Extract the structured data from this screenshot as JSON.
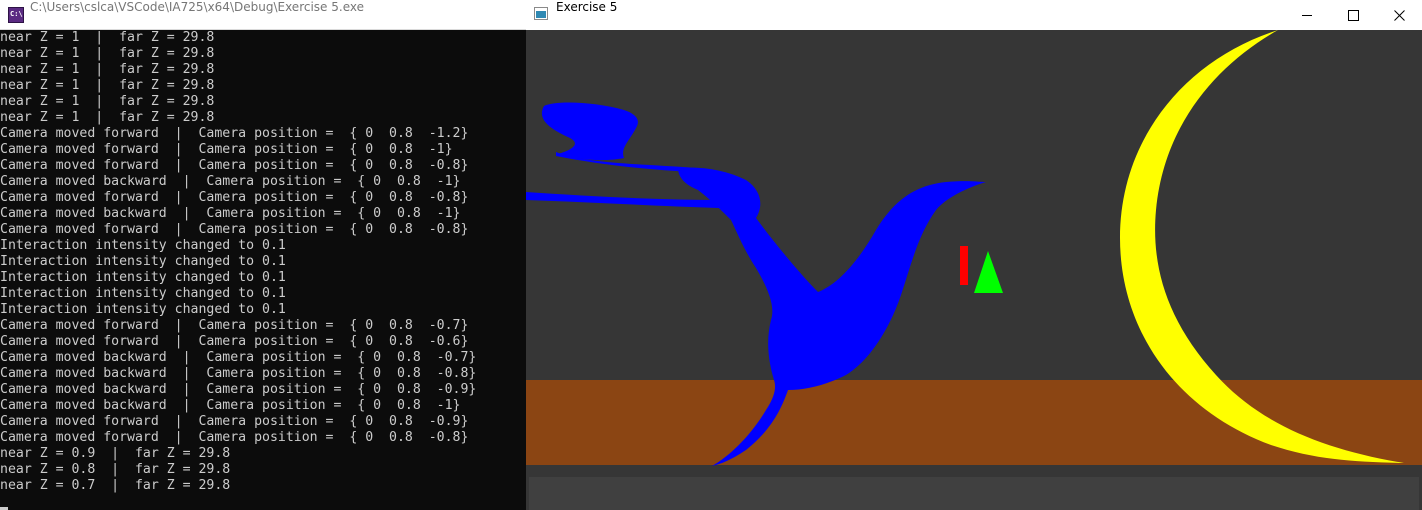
{
  "console": {
    "title": "C:\\Users\\cslca\\VSCode\\IA725\\x64\\Debug\\Exercise 5.exe",
    "icon": "console-app-icon",
    "icon_text": "C:\\",
    "lines": [
      "near Z = 1  |  far Z = 29.8",
      "near Z = 1  |  far Z = 29.8",
      "near Z = 1  |  far Z = 29.8",
      "near Z = 1  |  far Z = 29.8",
      "near Z = 1  |  far Z = 29.8",
      "near Z = 1  |  far Z = 29.8",
      "Camera moved forward  |  Camera position =  { 0  0.8  -1.2}",
      "Camera moved forward  |  Camera position =  { 0  0.8  -1}",
      "Camera moved forward  |  Camera position =  { 0  0.8  -0.8}",
      "Camera moved backward  |  Camera position =  { 0  0.8  -1}",
      "Camera moved forward  |  Camera position =  { 0  0.8  -0.8}",
      "Camera moved backward  |  Camera position =  { 0  0.8  -1}",
      "Camera moved forward  |  Camera position =  { 0  0.8  -0.8}",
      "Interaction intensity changed to 0.1",
      "Interaction intensity changed to 0.1",
      "Interaction intensity changed to 0.1",
      "Interaction intensity changed to 0.1",
      "Interaction intensity changed to 0.1",
      "Camera moved forward  |  Camera position =  { 0  0.8  -0.7}",
      "Camera moved forward  |  Camera position =  { 0  0.8  -0.6}",
      "Camera moved backward  |  Camera position =  { 0  0.8  -0.7}",
      "Camera moved backward  |  Camera position =  { 0  0.8  -0.8}",
      "Camera moved backward  |  Camera position =  { 0  0.8  -0.9}",
      "Camera moved backward  |  Camera position =  { 0  0.8  -1}",
      "Camera moved forward  |  Camera position =  { 0  0.8  -0.9}",
      "Camera moved forward  |  Camera position =  { 0  0.8  -0.8}",
      "near Z = 0.9  |  far Z = 29.8",
      "near Z = 0.8  |  far Z = 29.8",
      "near Z = 0.7  |  far Z = 29.8"
    ]
  },
  "gl_window": {
    "title": "Exercise 5",
    "icon": "window-app-icon",
    "buttons": {
      "minimize": "minimize-icon",
      "maximize": "maximize-icon",
      "close": "close-icon"
    }
  },
  "scene": {
    "colors": {
      "background": "#363636",
      "floor": "#8b4513",
      "teapot": "#0000ff",
      "moon": "#ffff00",
      "bar": "#ff0000",
      "cone": "#00ff00",
      "bottom_panel": "#404040"
    }
  }
}
